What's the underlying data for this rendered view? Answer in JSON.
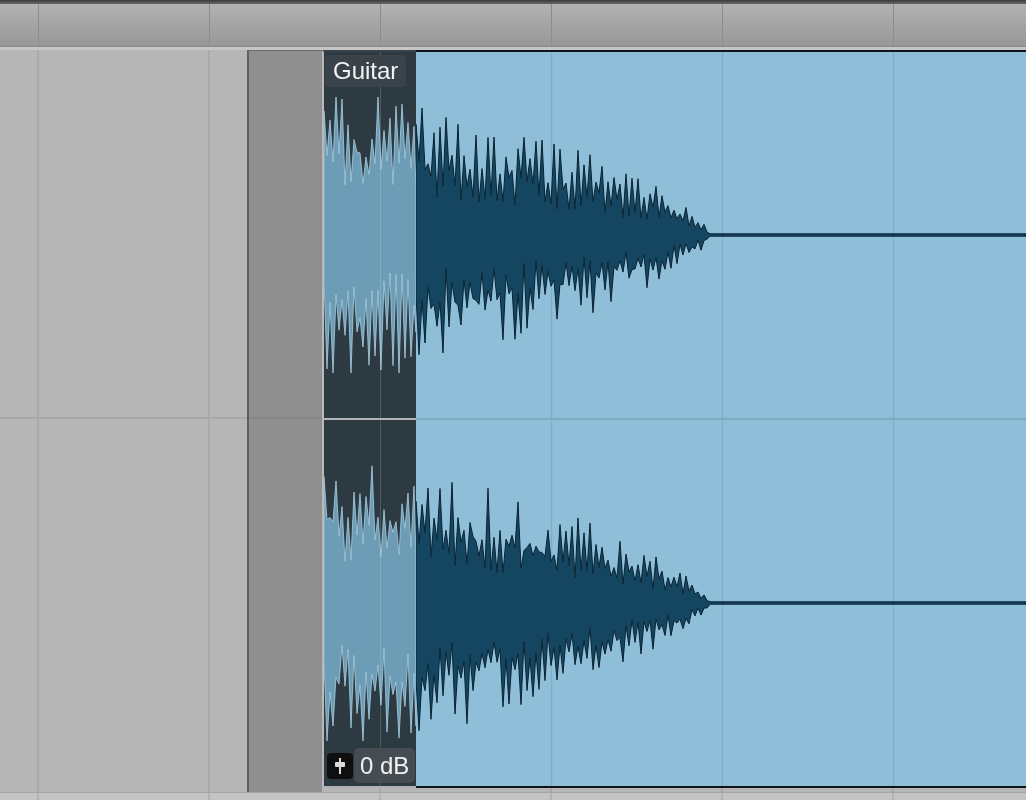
{
  "region": {
    "name": "Guitar",
    "gain": "0 dB"
  }
}
